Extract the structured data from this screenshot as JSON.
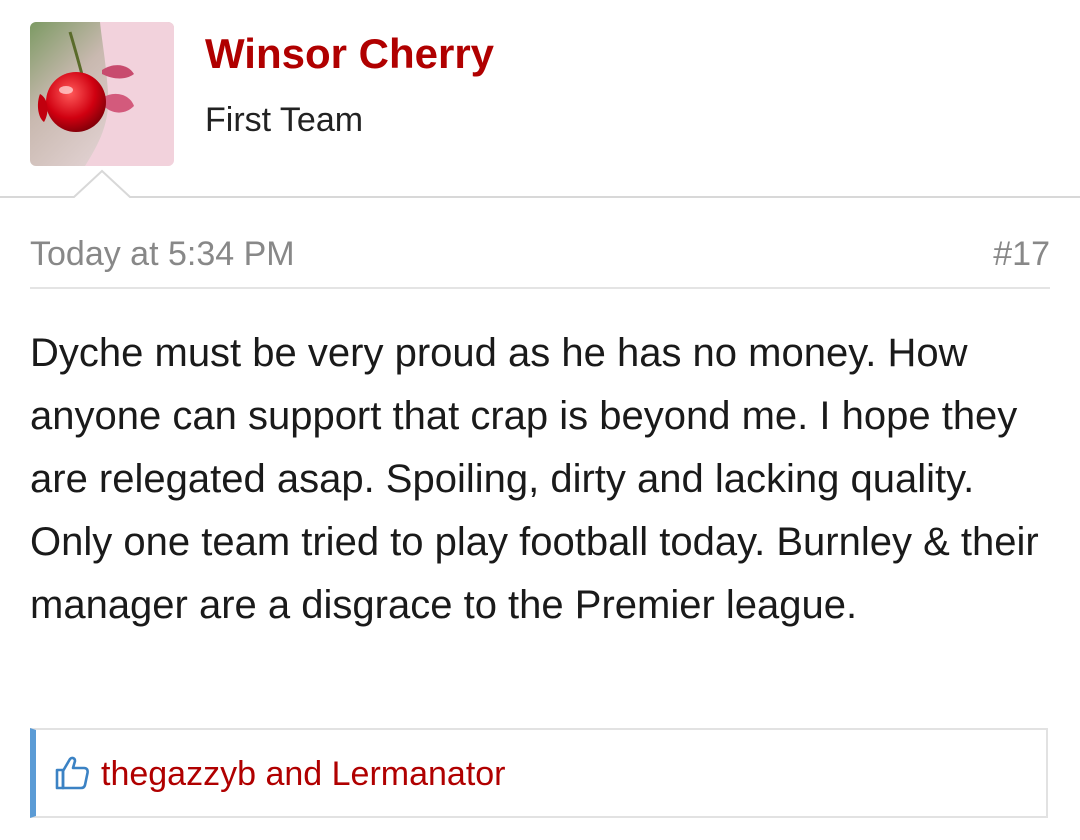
{
  "user": {
    "name": "Winsor Cherry",
    "title": "First Team",
    "avatar_icon": "cherry-lips-avatar"
  },
  "post": {
    "date": "Today at 5:34 PM",
    "number": "#17",
    "body": "Dyche must be very proud as he has no money. How anyone can support that crap is beyond me. I hope they are relegated asap. Spoiling, dirty and lacking quality. Only one team tried to play football today. Burnley & their manager are a disgrace to the Premier league."
  },
  "likes": {
    "icon": "thumbs-up-icon",
    "user1": "thegazzyb",
    "connector": " and ",
    "user2": "Lermanator"
  },
  "colors": {
    "username": "#b00000",
    "link": "#b00000",
    "meta_text": "#888888",
    "like_accent": "#5b9bd5"
  }
}
